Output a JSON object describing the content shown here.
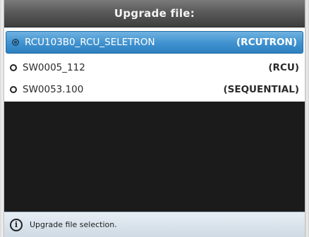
{
  "dialog": {
    "title": "Upgrade file:"
  },
  "files": [
    {
      "name": "RCU103B0_RCU_SELETRON",
      "type": "(RCUTRON)",
      "selected": true
    },
    {
      "name": "SW0005_112",
      "type": "(RCU)",
      "selected": false
    },
    {
      "name": "SW0053.100",
      "type": "(SEQUENTIAL)",
      "selected": false
    }
  ],
  "status": {
    "icon": "info-icon",
    "text": "Upgrade file selection."
  },
  "colors": {
    "selection": "#3f91cf",
    "title_bar": "#5a5a5a",
    "background": "#1b1b1b",
    "status_bar": "#dce5ee"
  }
}
